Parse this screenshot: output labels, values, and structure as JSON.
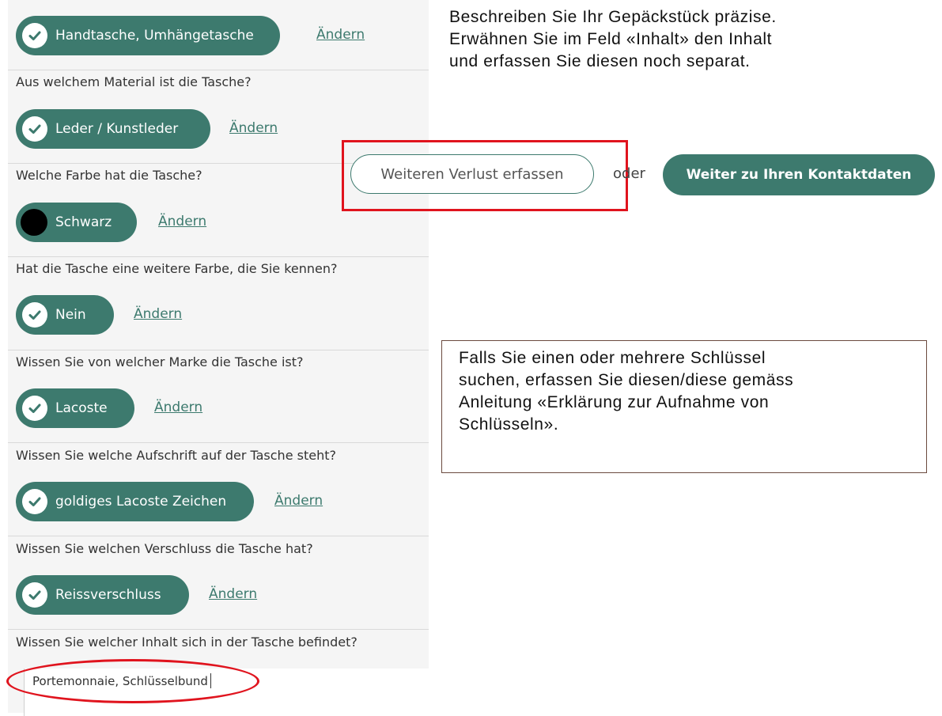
{
  "form": {
    "items": [
      {
        "answer": "Handtasche, Umhängetasche",
        "change_label": "Ändern"
      },
      {
        "question": "Aus welchem Material ist die Tasche?",
        "answer": "Leder / Kunstleder",
        "change_label": "Ändern"
      },
      {
        "question": "Welche Farbe hat die Tasche?",
        "answer": "Schwarz",
        "change_label": "Ändern",
        "swatch_color": "#000000"
      },
      {
        "question": "Hat die Tasche eine weitere Farbe, die Sie kennen?",
        "answer": "Nein",
        "change_label": "Ändern"
      },
      {
        "question": "Wissen Sie von welcher Marke die Tasche ist?",
        "answer": "Lacoste",
        "change_label": "Ändern"
      },
      {
        "question": "Wissen Sie welche Aufschrift auf der Tasche steht?",
        "answer": "goldiges Lacoste Zeichen",
        "change_label": "Ändern"
      },
      {
        "question": "Wissen Sie welchen Verschluss die Tasche hat?",
        "answer": "Reissverschluss",
        "change_label": "Ändern"
      },
      {
        "question": "Wissen Sie welcher Inhalt sich in der Tasche befindet?"
      }
    ],
    "content_field_value": "Portemonnaie, Schlüsselbund"
  },
  "actions": {
    "add_loss_label": "Weiteren Verlust erfassen",
    "or_label": "oder",
    "continue_label": "Weiter zu Ihren Kontaktdaten"
  },
  "notes": {
    "top": [
      "Beschreiben Sie Ihr Gepäckstück präzise.",
      "Erwähnen Sie im Feld «Inhalt» den Inhalt",
      "und erfassen Sie diesen noch separat."
    ],
    "box": [
      "Falls Sie einen oder mehrere Schlüssel",
      "suchen, erfassen Sie diesen/diese gemäss",
      "Anleitung «Erklärung zur Aufnahme von",
      "Schlüsseln»."
    ]
  },
  "colors": {
    "accent": "#3d7a6e",
    "annotation_red": "#e0141e",
    "panel_bg": "#f5f5f5"
  },
  "icons": {
    "answer_check": "check-circle-icon"
  }
}
